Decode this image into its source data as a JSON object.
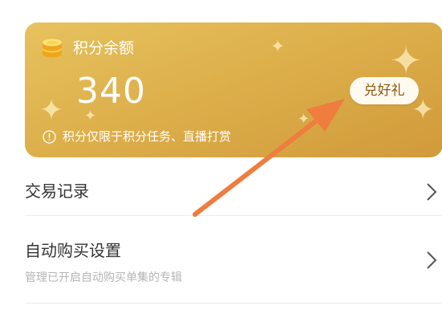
{
  "points_card": {
    "title": "积分余额",
    "balance": "340",
    "redeem_label": "兑好礼",
    "notice": "积分仅限于积分任务、直播打赏"
  },
  "menu": {
    "items": [
      {
        "label": "交易记录"
      },
      {
        "label": "自动购买设置",
        "sublabel": "管理已开启自动购买单集的专辑"
      }
    ]
  },
  "colors": {
    "card_gold": "#ddb04c",
    "annotation_arrow": "#ee7d3e"
  },
  "icons": [
    "coin-stack-icon",
    "info-icon",
    "chevron-right-icon",
    "sparkle-icon"
  ]
}
